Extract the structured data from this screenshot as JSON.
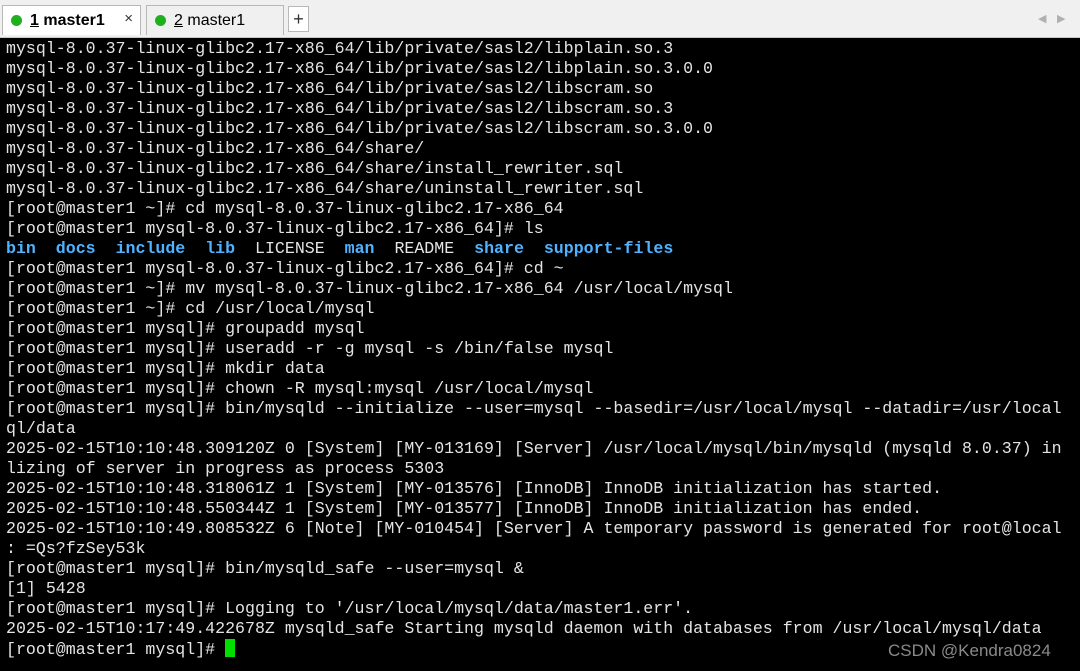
{
  "tabs": [
    {
      "num": "1",
      "label": "master1",
      "dot_color": "#1db11d",
      "active": true
    },
    {
      "num": "2",
      "label": "master1",
      "dot_color": "#1db11d",
      "active": false
    }
  ],
  "tab_close_symbol": "×",
  "tab_add_symbol": "+",
  "nav_left_symbol": "◀",
  "nav_right_symbol": "▶",
  "terminal": {
    "lines_before_ls": [
      "mysql-8.0.37-linux-glibc2.17-x86_64/lib/private/sasl2/libplain.so.3",
      "mysql-8.0.37-linux-glibc2.17-x86_64/lib/private/sasl2/libplain.so.3.0.0",
      "mysql-8.0.37-linux-glibc2.17-x86_64/lib/private/sasl2/libscram.so",
      "mysql-8.0.37-linux-glibc2.17-x86_64/lib/private/sasl2/libscram.so.3",
      "mysql-8.0.37-linux-glibc2.17-x86_64/lib/private/sasl2/libscram.so.3.0.0",
      "mysql-8.0.37-linux-glibc2.17-x86_64/share/",
      "mysql-8.0.37-linux-glibc2.17-x86_64/share/install_rewriter.sql",
      "mysql-8.0.37-linux-glibc2.17-x86_64/share/uninstall_rewriter.sql",
      "[root@master1 ~]# cd mysql-8.0.37-linux-glibc2.17-x86_64",
      "[root@master1 mysql-8.0.37-linux-glibc2.17-x86_64]# ls"
    ],
    "ls_output": [
      {
        "name": "bin",
        "dir": true
      },
      {
        "name": "docs",
        "dir": true
      },
      {
        "name": "include",
        "dir": true
      },
      {
        "name": "lib",
        "dir": true
      },
      {
        "name": "LICENSE",
        "dir": false
      },
      {
        "name": "man",
        "dir": true
      },
      {
        "name": "README",
        "dir": false
      },
      {
        "name": "share",
        "dir": true
      },
      {
        "name": "support-files",
        "dir": true
      }
    ],
    "lines_after_ls": [
      "[root@master1 mysql-8.0.37-linux-glibc2.17-x86_64]# cd ~",
      "[root@master1 ~]# mv mysql-8.0.37-linux-glibc2.17-x86_64 /usr/local/mysql",
      "[root@master1 ~]# cd /usr/local/mysql",
      "[root@master1 mysql]# groupadd mysql",
      "[root@master1 mysql]# useradd -r -g mysql -s /bin/false mysql",
      "[root@master1 mysql]# mkdir data",
      "[root@master1 mysql]# chown -R mysql:mysql /usr/local/mysql",
      "[root@master1 mysql]# bin/mysqld --initialize --user=mysql --basedir=/usr/local/mysql --datadir=/usr/local",
      "ql/data",
      "2025-02-15T10:10:48.309120Z 0 [System] [MY-013169] [Server] /usr/local/mysql/bin/mysqld (mysqld 8.0.37) in",
      "lizing of server in progress as process 5303",
      "2025-02-15T10:10:48.318061Z 1 [System] [MY-013576] [InnoDB] InnoDB initialization has started.",
      "2025-02-15T10:10:48.550344Z 1 [System] [MY-013577] [InnoDB] InnoDB initialization has ended.",
      "2025-02-15T10:10:49.808532Z 6 [Note] [MY-010454] [Server] A temporary password is generated for root@local",
      ": =Qs?fzSey53k",
      "[root@master1 mysql]# bin/mysqld_safe --user=mysql &",
      "[1] 5428",
      "[root@master1 mysql]# Logging to '/usr/local/mysql/data/master1.err'.",
      "2025-02-15T10:17:49.422678Z mysqld_safe Starting mysqld daemon with databases from /usr/local/mysql/data"
    ],
    "prompt": "[root@master1 mysql]# ",
    "cursor_color": "#00e000",
    "dir_color": "#4fb3ff",
    "text_color": "#e4e4e4",
    "background": "#000000"
  },
  "watermark": "CSDN @Kendra0824"
}
